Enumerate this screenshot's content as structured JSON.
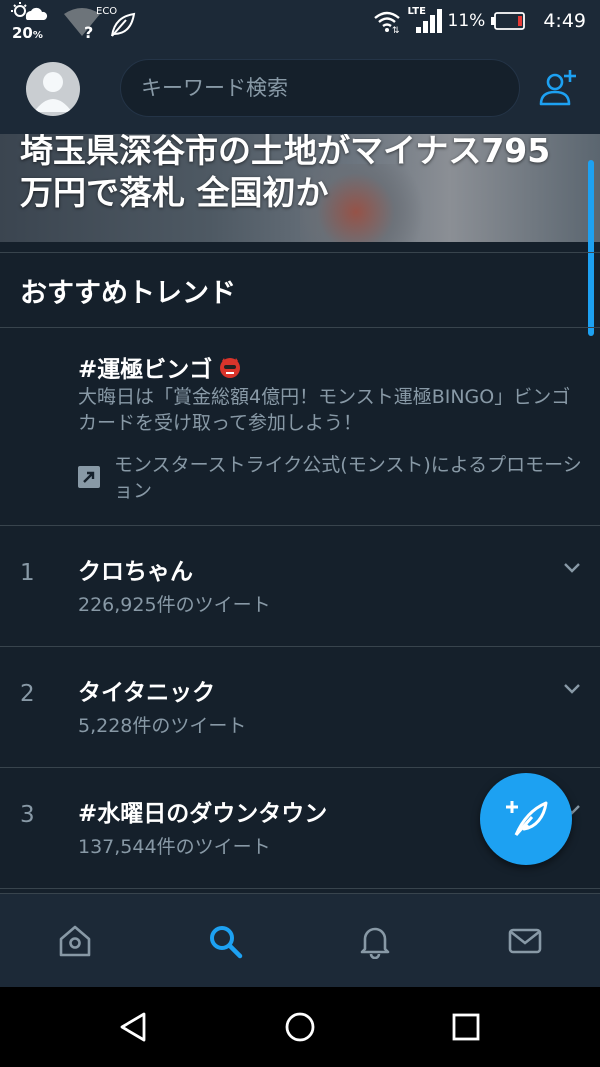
{
  "status_bar": {
    "temperature": "20",
    "temperature_unit": "%",
    "eco_label": "ECO",
    "network_label": "LTE",
    "battery_percent": "11%",
    "time": "4:49"
  },
  "header": {
    "search_placeholder": "キーワード検索"
  },
  "hero": {
    "title": "埼玉県深谷市の土地がマイナス795万円で落札 全国初か"
  },
  "section": {
    "title": "おすすめトレンド"
  },
  "promoted": {
    "hashtag": "#運極ビンゴ",
    "description": "大晦日は「賞金総額4億円！モンスト運極BINGO」ビンゴカードを受け取って参加しよう！",
    "promoted_by": "モンスターストライク公式(モンスト)によるプロモーション"
  },
  "trends": [
    {
      "rank": "1",
      "name": "クロちゃん",
      "count": "226,925件のツイート"
    },
    {
      "rank": "2",
      "name": "タイタニック",
      "count": "5,228件のツイート"
    },
    {
      "rank": "3",
      "name": "#水曜日のダウンタウン",
      "count": "137,544件のツイート"
    }
  ],
  "colors": {
    "background": "#15202b",
    "bar": "#1c2937",
    "accent": "#1da1f2",
    "secondary_text": "#8899a6",
    "divider": "#38444d"
  },
  "icons": {
    "home": "home-icon",
    "search": "search-icon",
    "notifications": "bell-icon",
    "messages": "mail-icon",
    "compose": "compose-tweet-icon",
    "add_user": "add-user-icon"
  }
}
